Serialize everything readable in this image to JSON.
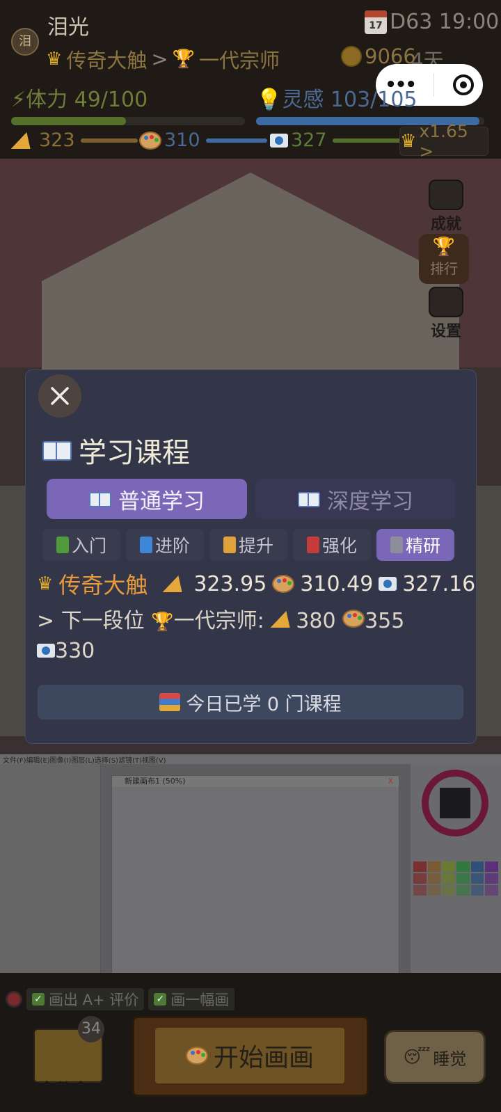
{
  "header": {
    "avatar_text": "泪",
    "player_name": "泪光",
    "calendar_day": "17",
    "day_time": "D63 19:00",
    "rank_current": "传奇大触",
    "rank_sep": ">",
    "rank_next": "一代宗师",
    "coins": "9066",
    "days_left": "4天",
    "stamina": "体力 49/100",
    "stamina_fraction": 0.49,
    "inspiration": "灵感 103/105",
    "inspiration_fraction": 0.98,
    "skill_1": "323",
    "skill_2": "310",
    "skill_3": "327",
    "multiplier": "x1.65 >"
  },
  "side": {
    "achievements": "成就",
    "ranking": "排行",
    "settings": "设置"
  },
  "painter": {
    "menu": "文件(F)编辑(E)图像(I)图层(L)选择(S)滤镜(T)视图(V)",
    "canvas_title": "新建画布1 (50%)",
    "close": "X"
  },
  "bottom": {
    "task_1": "画出 A+ 评价",
    "task_2": "画一幅画",
    "folder_count": "34",
    "folder_label": "文件夹",
    "start_label": "开始画画",
    "sleep_label": "睡觉"
  },
  "modal": {
    "title": "学习课程",
    "tabs": [
      "普通学习",
      "深度学习"
    ],
    "levels": [
      "入门",
      "进阶",
      "提升",
      "强化",
      "精研"
    ],
    "level_colors": [
      "#4f9a3a",
      "#3e86d6",
      "#e0a03a",
      "#c53b3b",
      "#8e8e9a"
    ],
    "rank_name": "传奇大触",
    "stat_1": "323.95",
    "stat_2": "310.49",
    "stat_3": "327.16",
    "next_prefix": "> 下一段位",
    "next_rank": "一代宗师:",
    "next_1": "380",
    "next_2": "355",
    "next_3": "330",
    "today_count": "今日已学 0 门课程"
  }
}
